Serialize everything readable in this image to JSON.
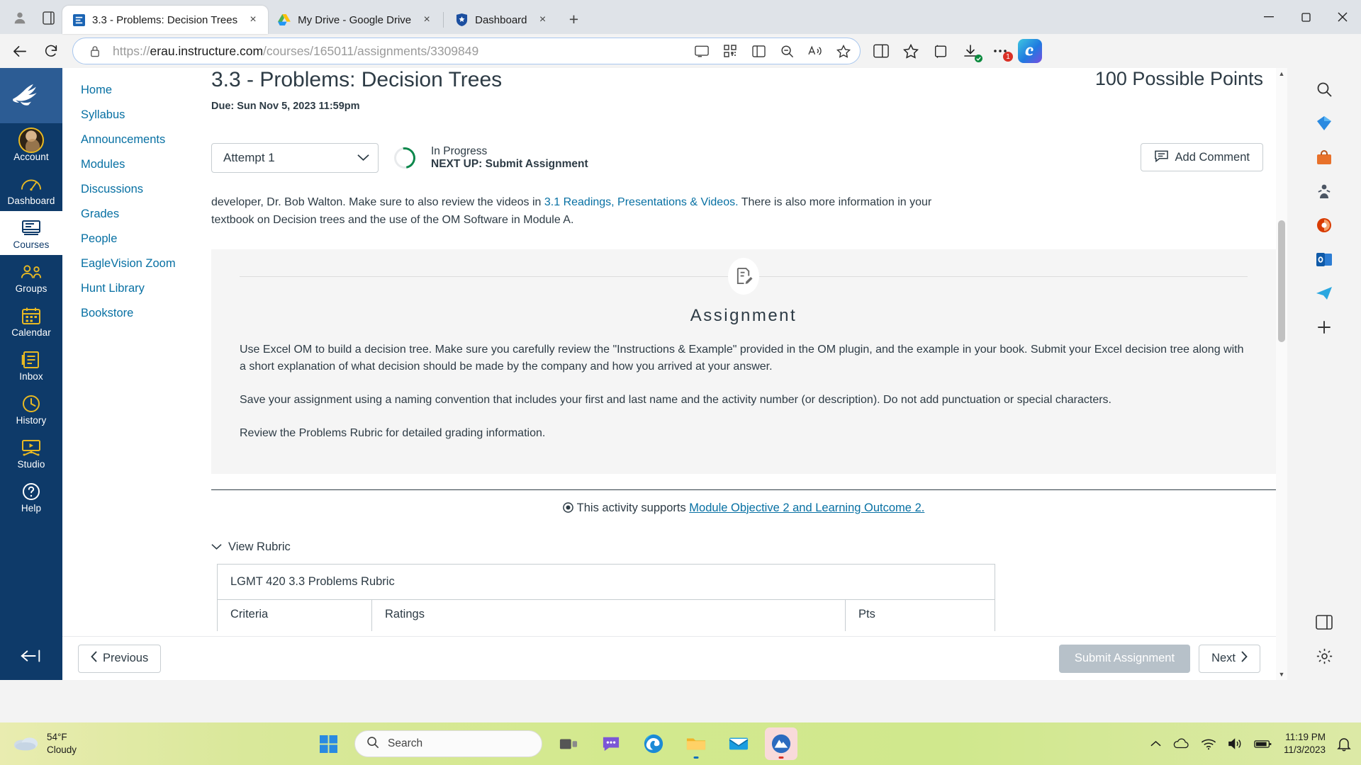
{
  "browser": {
    "tabs": [
      {
        "title": "3.3 - Problems: Decision Trees",
        "favicon": "canvas-icon",
        "active": true,
        "close_label": "×"
      },
      {
        "title": "My Drive - Google Drive",
        "favicon": "google-drive-icon",
        "active": false,
        "close_label": "×"
      },
      {
        "title": "Dashboard",
        "favicon": "shield-star-icon",
        "active": false,
        "close_label": ""
      }
    ],
    "new_tab_label": "+",
    "window_controls": {
      "minimize": "─",
      "maximize": "❐",
      "close": "✕"
    },
    "url": {
      "scheme": "https://",
      "host": "erau.instructure.com",
      "path": "/courses/165011/assignments/3309849"
    },
    "notification_count": "1"
  },
  "global_nav": {
    "logo": "eagle-logo",
    "items": [
      {
        "label": "Account",
        "icon": "avatar-icon",
        "active": false
      },
      {
        "label": "Dashboard",
        "icon": "speedometer-icon",
        "active": false
      },
      {
        "label": "Courses",
        "icon": "book-icon",
        "active": true
      },
      {
        "label": "Groups",
        "icon": "people-icon",
        "active": false
      },
      {
        "label": "Calendar",
        "icon": "calendar-icon",
        "active": false
      },
      {
        "label": "Inbox",
        "icon": "inbox-icon",
        "active": false
      },
      {
        "label": "History",
        "icon": "clock-icon",
        "active": false
      },
      {
        "label": "Studio",
        "icon": "studio-icon",
        "active": false
      },
      {
        "label": "Help",
        "icon": "question-circle-icon",
        "active": false
      }
    ]
  },
  "course_nav": {
    "items": [
      "Home",
      "Syllabus",
      "Announcements",
      "Modules",
      "Discussions",
      "Grades",
      "People",
      "EagleVision Zoom",
      "Hunt Library",
      "Bookstore"
    ]
  },
  "assignment": {
    "title": "3.3 - Problems: Decision Trees",
    "due": "Due: Sun Nov 5, 2023 11:59pm",
    "points": "100 Possible Points",
    "attempt_label": "Attempt 1",
    "status_line1": "In Progress",
    "status_line2": "NEXT UP: Submit Assignment",
    "add_comment_label": "Add Comment",
    "description_top_pre": "developer, Dr. Bob Walton. Make sure to also review the videos in ",
    "description_top_link": "3.1 Readings, Presentations & Videos.",
    "description_top_post": " There is also more information in your textbook on Decision trees and the use of the OM Software in Module A.",
    "card_heading": "Assignment",
    "card_icon": "assignment-document-icon",
    "paragraphs": [
      "Use Excel OM to build a decision tree. Make sure you carefully review the \"Instructions & Example\" provided in the OM plugin, and the example in your book. Submit your Excel decision tree along with a short explanation of what decision should be made by the company and how you arrived at your answer.",
      "Save your assignment using a naming convention that includes your first and last name and the activity number (or description). Do not add punctuation or special characters.",
      "Review the Problems Rubric for detailed grading information."
    ],
    "supports_prefix": "This activity supports ",
    "supports_link": "Module Objective 2 and Learning Outcome 2."
  },
  "rubric": {
    "toggle_label": "View Rubric",
    "title": "LGMT 420 3.3 Problems Rubric",
    "columns": [
      "Criteria",
      "Ratings",
      "Pts"
    ]
  },
  "footer": {
    "previous_label": "Previous",
    "submit_label": "Submit Assignment",
    "next_label": "Next"
  },
  "taskbar": {
    "weather_temp": "54°F",
    "weather_cond": "Cloudy",
    "search_placeholder": "Search",
    "apps": [
      "start-icon",
      "search-box",
      "taskview-icon",
      "chat-icon",
      "edge-icon",
      "explorer-icon",
      "mail-icon",
      "nordvpn-icon"
    ],
    "time": "11:19 PM",
    "date": "11/3/2023"
  }
}
